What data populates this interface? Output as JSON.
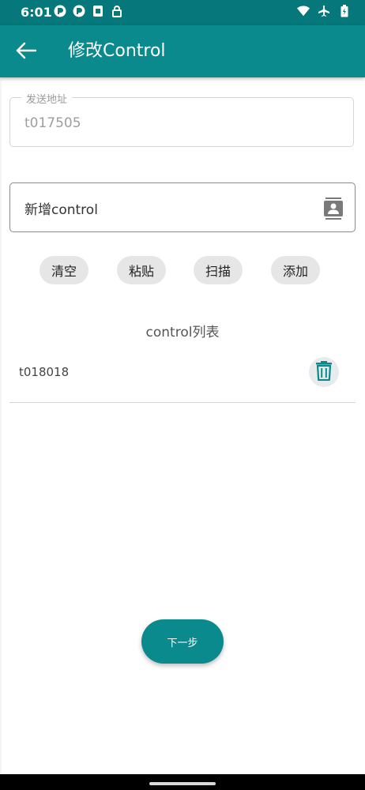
{
  "status_bar": {
    "time": "6:01",
    "left_icons": [
      "app-notification-icon",
      "app-notification-icon",
      "sim-card-icon",
      "lock-icon"
    ],
    "right_icons": [
      "wifi-icon",
      "airplane-mode-icon",
      "battery-icon"
    ]
  },
  "app_bar": {
    "title": "修改Control",
    "back_icon": "arrow-left-icon",
    "background": "#0b8a8d"
  },
  "sender": {
    "label": "发送地址",
    "value": "t017505"
  },
  "new_control": {
    "placeholder": "新增control",
    "contacts_icon": "contacts-icon"
  },
  "actions": {
    "clear": "清空",
    "paste": "粘贴",
    "scan": "扫描",
    "add": "添加"
  },
  "control_list": {
    "title": "control列表",
    "items": [
      {
        "address": "t018018",
        "delete_icon": "trash-icon"
      }
    ]
  },
  "next_button": "下一步"
}
